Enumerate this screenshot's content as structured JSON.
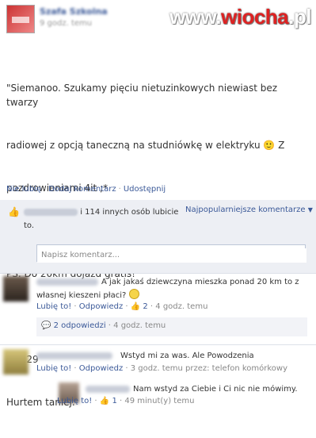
{
  "watermark": {
    "prefix": "www.",
    "brand": "wiocha",
    "suffix": ".pl"
  },
  "post": {
    "author": "Szafa Szkolna",
    "time": "9 godz. temu",
    "text_lines": [
      "\"Siemanoo. Szukamy pięciu nietuzinkowych niewiast bez twarzy",
      "radiowej z opcją taneczną na studniówkę w elektryku 🙂 Z",
      "pozdrowieniami 4it ;*",
      "",
      "PS. Do 20km dojazd gratis! \"",
      "",
      "#3229",
      "Hurtem taniej."
    ]
  },
  "actions": {
    "like": "Nie lubię",
    "comment": "Dodaj komentarz",
    "share": "Udostępnij",
    "sep": "·"
  },
  "likes": {
    "text": "i 114 innych osób lubicie",
    "to": "to."
  },
  "sort": {
    "label": "Najpopularniejsze komentarze",
    "arrow": "▼"
  },
  "comment_input": {
    "placeholder": "Napisz komentarz..."
  },
  "comments": [
    {
      "text_line1": "A jak jakaś dziewczyna mieszka ponad 20 km to z",
      "text_line2": "własnej kieszeni płaci?",
      "meta_like": "Lubię to!",
      "meta_reply": "Odpowiedz",
      "meta_count": "2",
      "meta_time": "4 godz. temu",
      "replies_link": "2 odpowiedzi",
      "replies_time": "4 godz. temu"
    },
    {
      "text_line1": "Wstyd mi za was. Ale Powodzenia",
      "meta_like": "Lubię to!",
      "meta_reply": "Odpowiedz",
      "meta_time": "3 godz. temu przez: telefon komórkowy"
    },
    {
      "text_line1": "Nam wstyd za Ciebie i Ci nic nie mówimy.",
      "meta_like": "Lubię to!",
      "meta_count": "1",
      "meta_time": "49 minut(y) temu"
    }
  ]
}
